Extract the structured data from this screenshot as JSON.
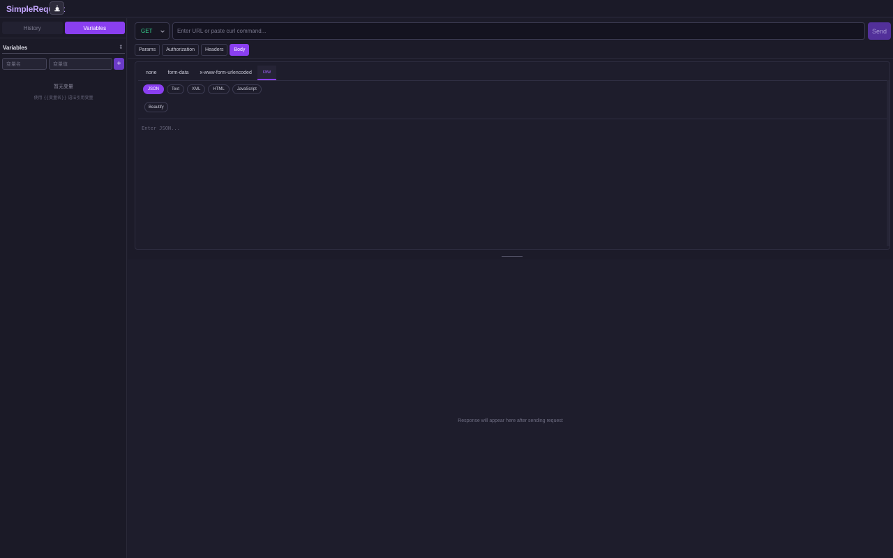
{
  "app": {
    "title": "SimpleRequest",
    "theme_icon": "sun-icon"
  },
  "sidebar": {
    "tabs": [
      {
        "label": "History",
        "active": false
      },
      {
        "label": "Variables",
        "active": true
      }
    ],
    "variables": {
      "title": "Variables",
      "toggle_icon": "expand-collapse-icon",
      "toggle_glyph": "⇕",
      "name_placeholder": "变量名",
      "value_placeholder": "变量值",
      "add_label": "+",
      "empty_title": "暂无变量",
      "empty_hint": "使用 {{变量名}} 语法引用变量"
    }
  },
  "request": {
    "method": "GET",
    "url_placeholder": "Enter URL or paste curl command...",
    "send_label": "Send",
    "tabs": [
      {
        "label": "Params",
        "active": false
      },
      {
        "label": "Authorization",
        "active": false
      },
      {
        "label": "Headers",
        "active": false
      },
      {
        "label": "Body",
        "active": true
      }
    ],
    "body": {
      "types": [
        {
          "label": "none",
          "active": false
        },
        {
          "label": "form-data",
          "active": false
        },
        {
          "label": "x-www-form-urlencoded",
          "active": false
        },
        {
          "label": "raw",
          "active": true
        }
      ],
      "raw_types": [
        {
          "label": "JSON",
          "active": true
        },
        {
          "label": "Text",
          "active": false
        },
        {
          "label": "XML",
          "active": false
        },
        {
          "label": "HTML",
          "active": false
        },
        {
          "label": "JavaScript",
          "active": false
        }
      ],
      "beautify_label": "Beautify",
      "editor_placeholder": "Enter JSON..."
    }
  },
  "response": {
    "empty_text": "Response will appear here after sending request"
  },
  "colors": {
    "accent": "#8a3ff0",
    "method_get": "#35d28e",
    "background": "#1e1d2c",
    "title": "#c4a6ff"
  }
}
